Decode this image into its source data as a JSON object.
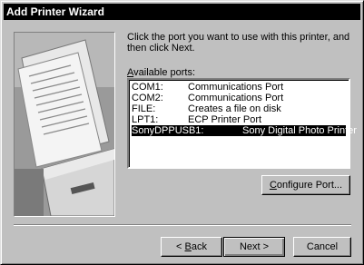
{
  "window": {
    "title": "Add Printer Wizard"
  },
  "instructions": "Click the port you want to use with this printer, and then click Next.",
  "ports": {
    "label_prefix": "",
    "label_accel": "A",
    "label_rest": "vailable ports:",
    "items": [
      {
        "port": "COM1:",
        "desc": "Communications Port",
        "selected": false
      },
      {
        "port": "COM2:",
        "desc": "Communications Port",
        "selected": false
      },
      {
        "port": "FILE:",
        "desc": "Creates a file on disk",
        "selected": false
      },
      {
        "port": "LPT1:",
        "desc": "ECP Printer Port",
        "selected": false
      },
      {
        "port": "SonyDPPUSB1:",
        "desc": "Sony Digital Photo Printer",
        "selected": true
      }
    ]
  },
  "buttons": {
    "configure_accel": "C",
    "configure_rest": "onfigure Port...",
    "back_prefix": "< ",
    "back_accel": "B",
    "back_rest": "ack",
    "next": "Next >",
    "cancel": "Cancel"
  }
}
